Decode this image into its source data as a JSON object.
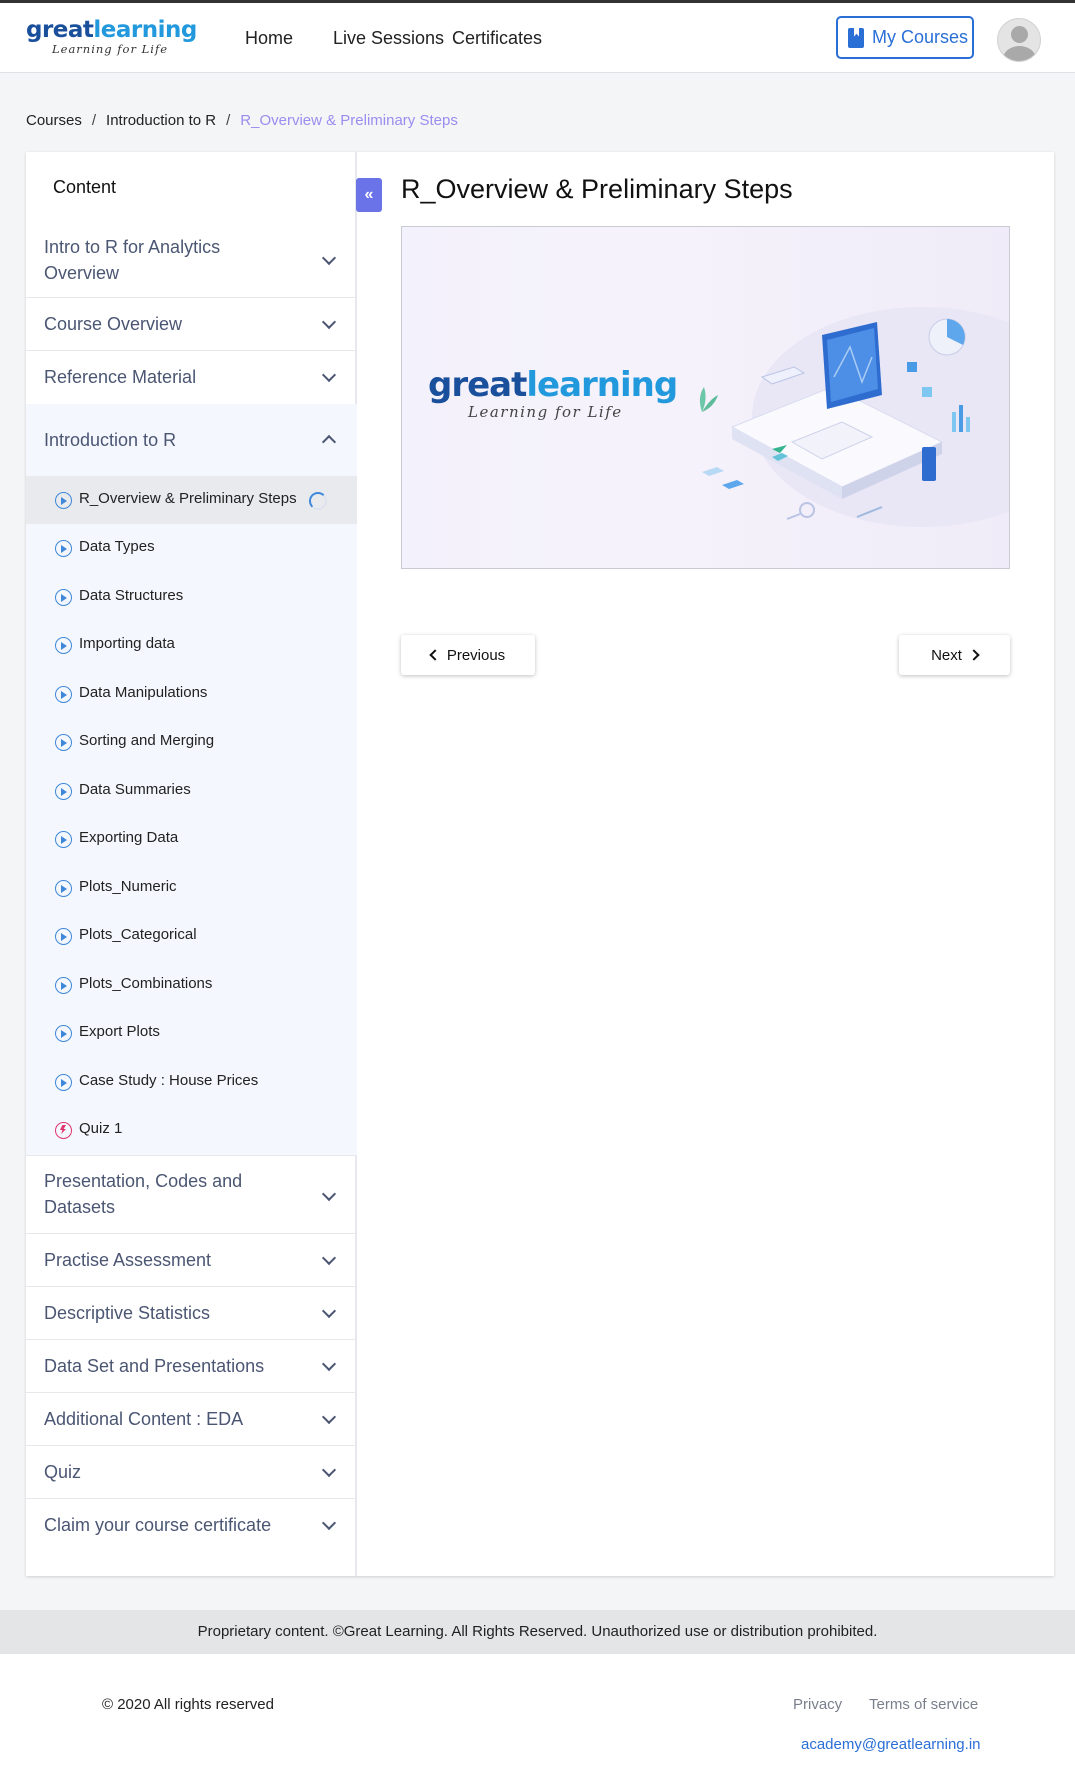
{
  "header": {
    "logo_main_a": "great",
    "logo_main_b": "learning",
    "logo_tagline": "Learning for Life",
    "nav": [
      "Home",
      "Live Sessions",
      "Certificates"
    ],
    "my_courses": "My Courses"
  },
  "breadcrumb": [
    "Courses",
    "Introduction to R",
    "R_Overview & Preliminary Steps"
  ],
  "sidebar": {
    "title": "Content",
    "sections_top": [
      {
        "label": "Intro to R for Analytics Overview"
      },
      {
        "label": "Course Overview"
      },
      {
        "label": "Reference Material"
      }
    ],
    "expanded": {
      "label": "Introduction to R",
      "lessons": [
        "R_Overview & Preliminary Steps",
        "Data Types",
        "Data Structures",
        "Importing data",
        "Data Manipulations",
        "Sorting and Merging",
        "Data Summaries",
        "Exporting Data",
        "Plots_Numeric",
        "Plots_Categorical",
        "Plots_Combinations",
        "Export Plots",
        "Case Study : House Prices",
        "Quiz 1"
      ]
    },
    "sections_bottom": [
      "Presentation, Codes and Datasets",
      "Practise Assessment",
      "Descriptive Statistics",
      "Data Set and Presentations",
      "Additional Content : EDA",
      "Quiz",
      "Claim your course certificate"
    ]
  },
  "main": {
    "title": "R_Overview & Preliminary Steps",
    "banner_logo_a": "great",
    "banner_logo_b": "learning",
    "banner_tagline": "Learning for Life",
    "prev_label": "Previous",
    "next_label": "Next"
  },
  "footer": {
    "notice": "Proprietary content. ©Great Learning. All Rights Reserved. Unauthorized use or distribution prohibited.",
    "copyright": "© 2020 All rights reserved",
    "privacy": "Privacy",
    "terms": "Terms of service",
    "email": "academy@greatlearning.in"
  },
  "colors": {
    "accent": "#2a6fd6",
    "collapse": "#6a73e8",
    "breadcrumb_current": "#9b8cf0",
    "quiz": "#e0336e"
  }
}
